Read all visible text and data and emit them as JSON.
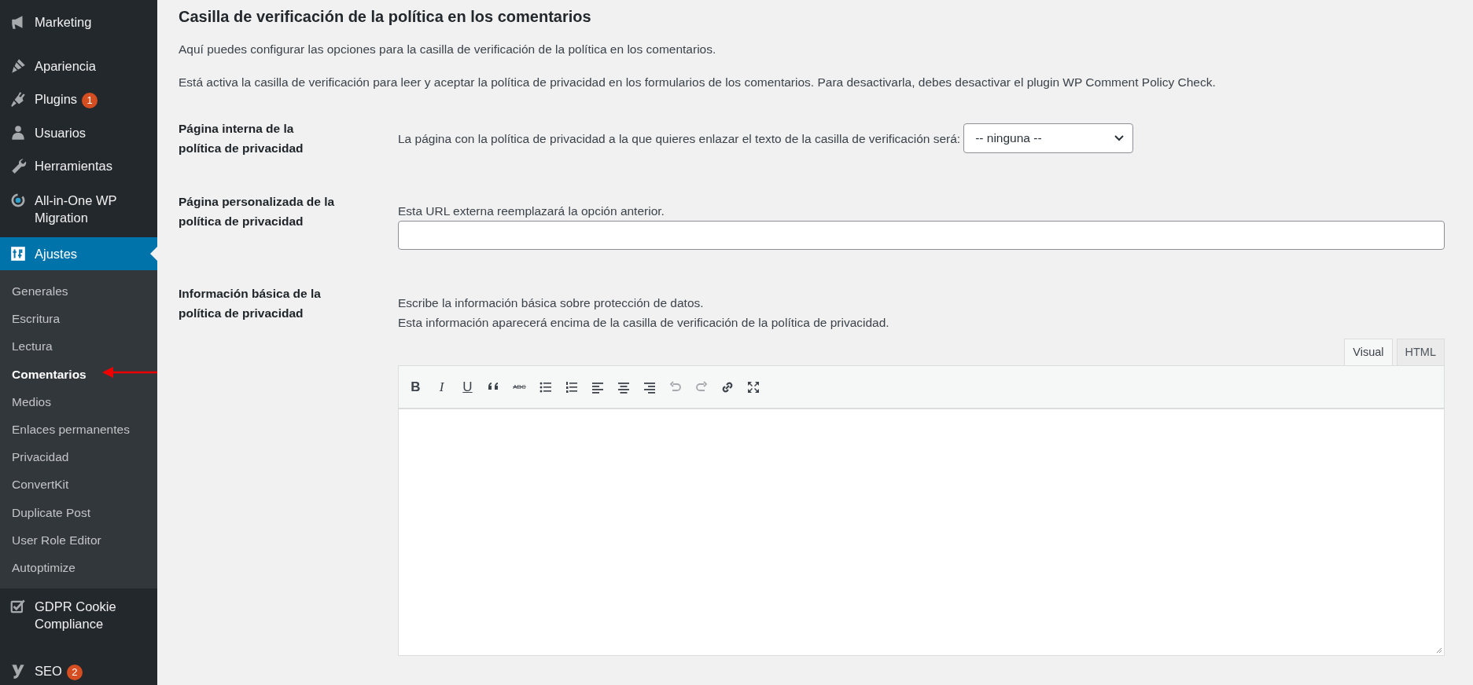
{
  "sidebar": {
    "groups": [
      {
        "items": [
          {
            "label": "Marketing",
            "selected": false
          }
        ]
      },
      {
        "items": [
          {
            "label": "Apariencia",
            "selected": false
          },
          {
            "label": "Plugins",
            "badge": "1",
            "selected": false
          },
          {
            "label": "Usuarios",
            "selected": false
          },
          {
            "label": "Herramientas",
            "selected": false
          },
          {
            "label": "All-in-One WP Migration",
            "selected": false
          },
          {
            "label": "Ajustes",
            "selected": true,
            "children": [
              {
                "label": "Generales",
                "selected": false
              },
              {
                "label": "Escritura",
                "selected": false
              },
              {
                "label": "Lectura",
                "selected": false
              },
              {
                "label": "Comentarios",
                "selected": true
              },
              {
                "label": "Medios",
                "selected": false
              },
              {
                "label": "Enlaces permanentes",
                "selected": false
              },
              {
                "label": "Privacidad",
                "selected": false
              },
              {
                "label": "ConvertKit",
                "selected": false
              },
              {
                "label": "Duplicate Post",
                "selected": false
              },
              {
                "label": "User Role Editor",
                "selected": false
              },
              {
                "label": "Autoptimize",
                "selected": false
              }
            ]
          },
          {
            "label": "GDPR Cookie Compliance",
            "selected": false
          }
        ]
      },
      {
        "items": [
          {
            "label": "SEO",
            "badge": "2",
            "selected": false
          }
        ]
      }
    ]
  },
  "main": {
    "title": "Casilla de verificación de la política en los comentarios",
    "descriptions": [
      "Aquí puedes configurar las opciones para la casilla de verificación de la política en los comentarios.",
      "Está activa la casilla de verificación para leer y aceptar la política de privacidad en los formularios de los comentarios. Para desactivarla, debes desactivar el plugin WP Comment Policy Check."
    ],
    "settings": [
      {
        "kind": "select",
        "label": "Página interna de la política de privacidad",
        "hints": [
          "La página con la política de privacidad a la que quieres enlazar el texto de la casilla de verificación será:"
        ],
        "value": "-- ninguna --"
      },
      {
        "kind": "text",
        "label": "Página personalizada de la política de privacidad",
        "hints": [
          "Esta URL externa reemplazará la opción anterior."
        ]
      },
      {
        "kind": "editor",
        "label": "Información básica de la política de privacidad",
        "hints": [
          "Escribe la información básica sobre protección de datos.",
          "Esta información aparecerá encima de la casilla de verificación de la política de privacidad."
        ],
        "tabs": [
          {
            "label": "Visual",
            "selected": true
          },
          {
            "label": "HTML",
            "selected": false
          }
        ],
        "toolbar": [
          {
            "kind": "bold",
            "text": "B"
          },
          {
            "kind": "italic",
            "text": "I"
          },
          {
            "kind": "underline",
            "text": "U"
          },
          {
            "kind": "quote"
          },
          {
            "kind": "strikethrough",
            "text": "ABC"
          },
          {
            "kind": "bullets"
          },
          {
            "kind": "numbers"
          },
          {
            "kind": "align-left"
          },
          {
            "kind": "align-center"
          },
          {
            "kind": "align-right"
          },
          {
            "kind": "undo"
          },
          {
            "kind": "redo"
          },
          {
            "kind": "link"
          },
          {
            "kind": "fullscreen"
          }
        ]
      }
    ]
  }
}
